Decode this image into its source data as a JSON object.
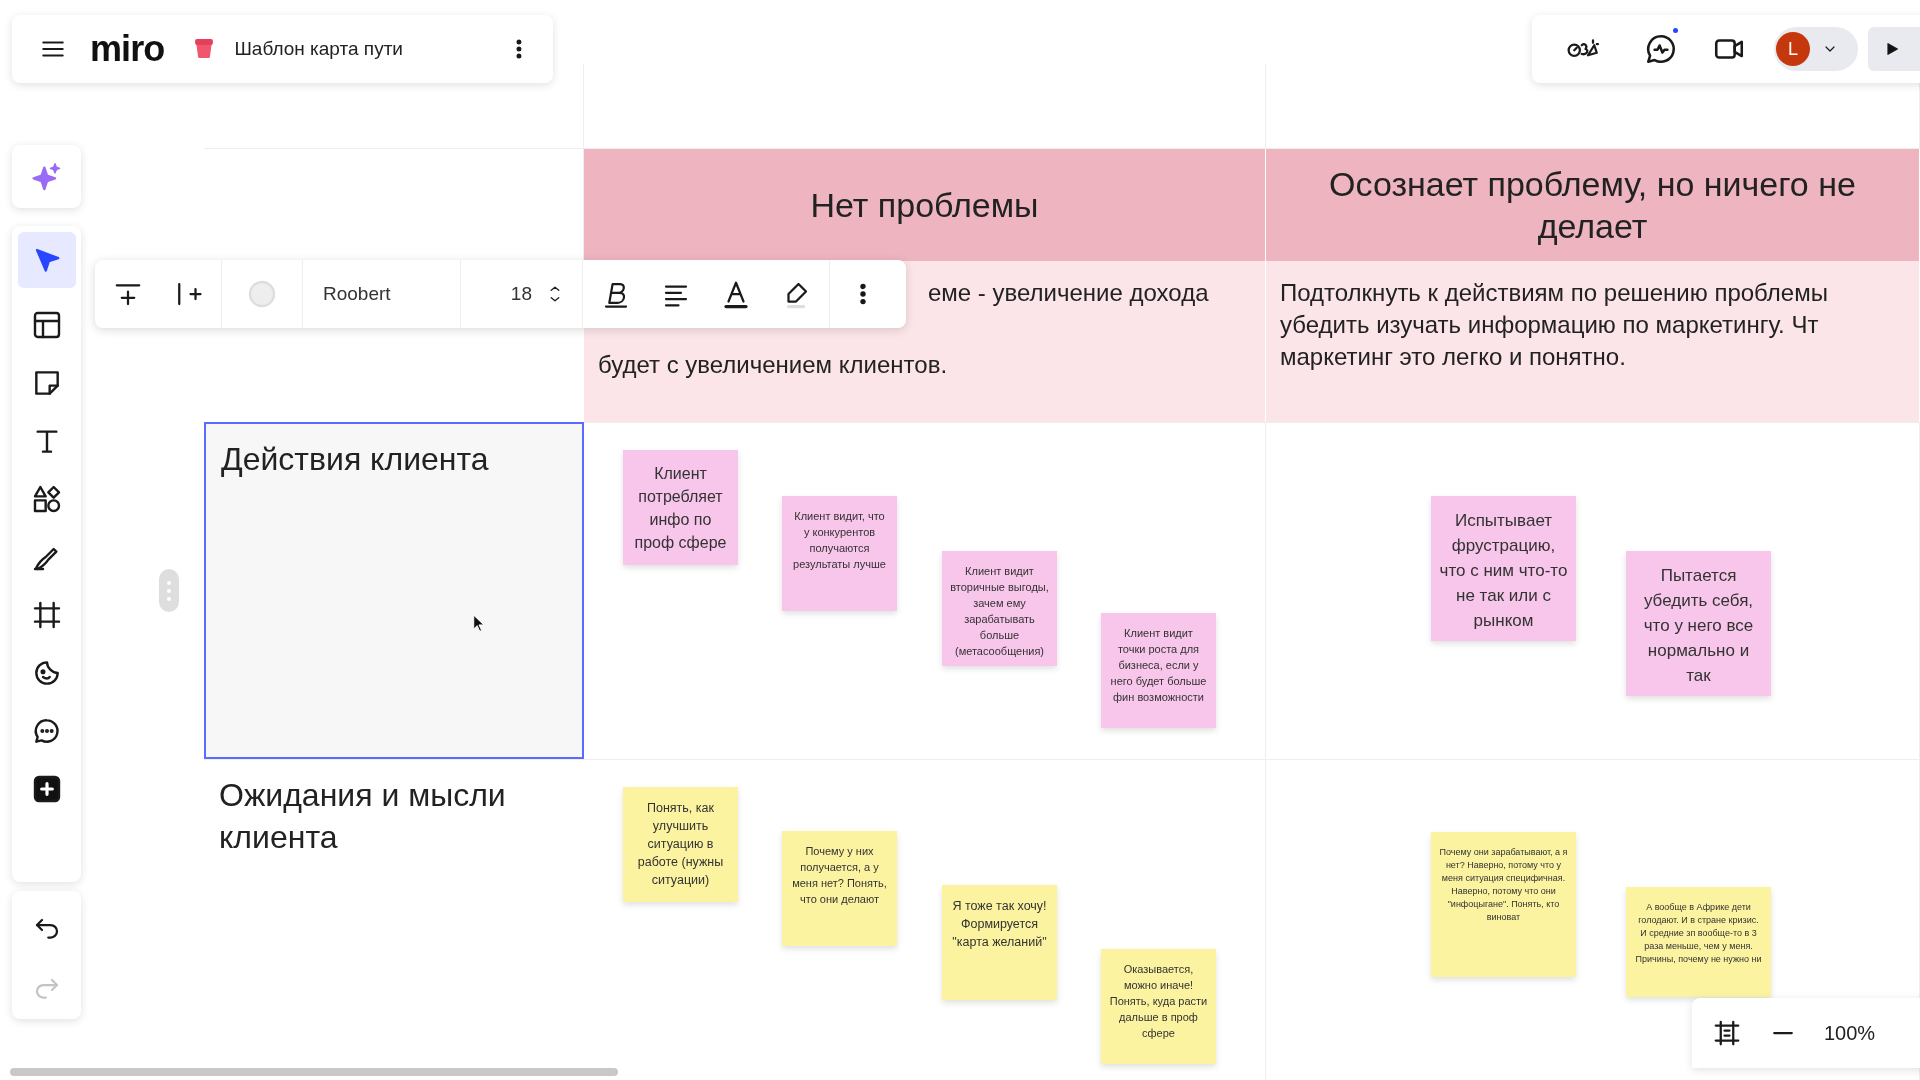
{
  "board": {
    "title": "Шаблон карта пути"
  },
  "logo": "miro",
  "format_toolbar": {
    "font": "Roobert",
    "size": "18"
  },
  "avatar": {
    "initial": "L"
  },
  "zoom": {
    "value": "100%"
  },
  "table": {
    "columns": [
      {
        "title": "Нет проблемы",
        "description": [
          "еме - увеличение дохода",
          "будет с увеличением клиентов."
        ]
      },
      {
        "title": "Осознает проблему, но ничего не делает",
        "description": [
          "Подтолкнуть к действиям по решению проблемы",
          "убедить изучать информацию по маркетингу. Чт",
          "маркетинг это легко и понятно."
        ]
      }
    ],
    "rows": [
      {
        "label": "Действия клиента",
        "selected": true,
        "color": "#f7c6ea",
        "notes": [
          [
            "Клиент потребляет инфо по проф сфере",
            "Клиент видит, что у конкурентов получаются результаты лучше",
            "Клиент видит вторичные выгоды, зачем ему зарабатывать больше (метасообщения)",
            "Клиент видит точки роста для бизнеса, если у него будет больше фин возможности"
          ],
          [
            "Испытывает фрустрацию, что с ним что-то не так или с рынком",
            "Пытается убедить себя, что у него все нормально и так"
          ]
        ]
      },
      {
        "label": "Ожидания и мысли клиента",
        "selected": false,
        "color": "#fbf3a0",
        "notes": [
          [
            "Понять, как улучшить ситуацию в работе (нужны ситуации)",
            "Почему у них получается, а у меня нет? Понять, что они делают",
            "Я тоже так хочу! Формируется \"карта желаний\"",
            "Оказывается, можно иначе! Понять, куда расти дальше в проф сфере"
          ],
          [
            "Почему они зарабатывают, а я нет? Наверно, потому что у меня ситуация специфичная. Наверно, потому что они \"инфоцыгане\". Понять, кто виноват",
            "А вообще в Африке дети голодают. И в стране кризис. И средние зп вообще-то в 3 раза меньше, чем у меня. Причины, почему не нужно ни"
          ]
        ]
      }
    ]
  }
}
